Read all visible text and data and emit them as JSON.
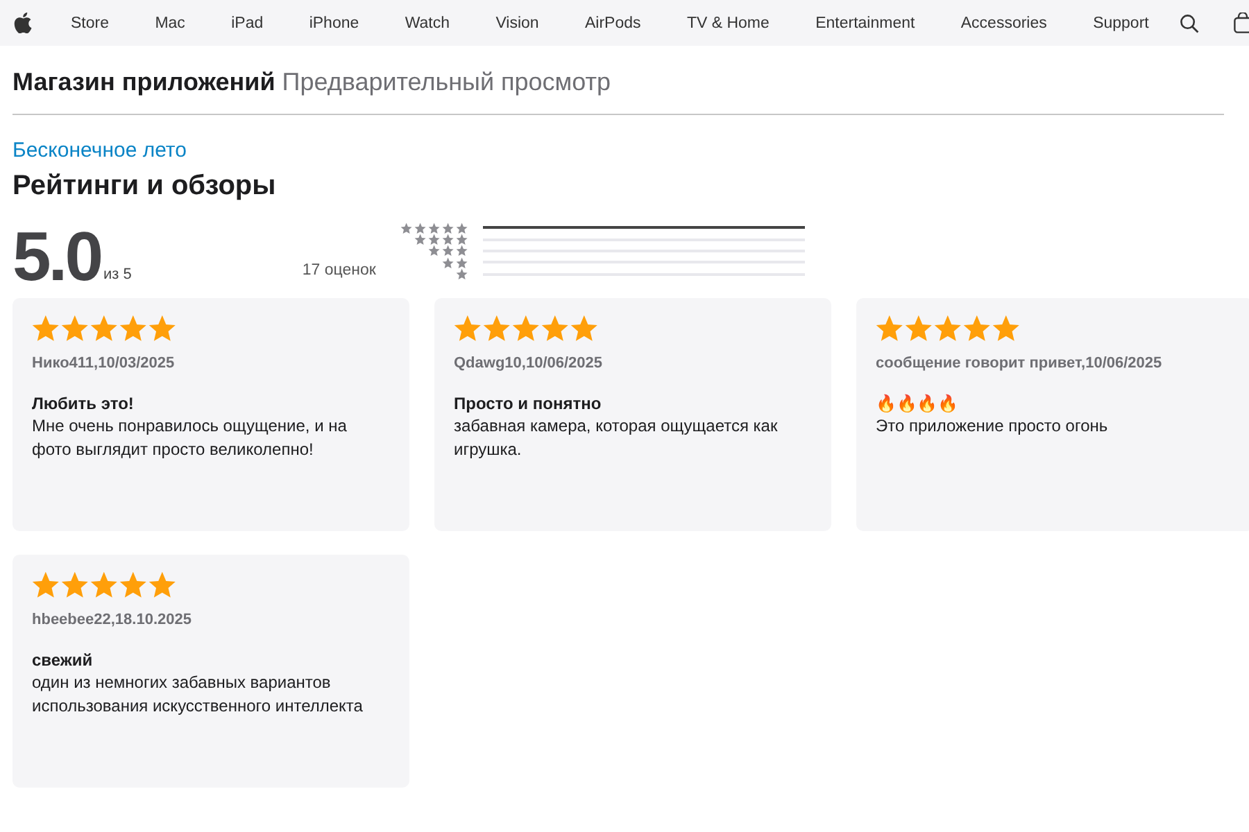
{
  "nav": {
    "items": [
      "Store",
      "Mac",
      "iPad",
      "iPhone",
      "Watch",
      "Vision",
      "AirPods",
      "TV & Home",
      "Entertainment",
      "Accessories",
      "Support"
    ]
  },
  "header": {
    "title": "Магазин приложений",
    "subtitle": "Предварительный просмотр"
  },
  "app_name": "Бесконечное лето",
  "section_title": "Рейтинги и обзоры",
  "summary": {
    "score": "5.0",
    "out_of": "из 5",
    "count": "17 оценок"
  },
  "histogram": [
    {
      "level": 1.0
    },
    {
      "level": 0
    },
    {
      "level": 0
    },
    {
      "level": 0
    },
    {
      "level": 0
    }
  ],
  "reviews": [
    {
      "stars": 5,
      "author": "Нико411,10/03/2025",
      "title": "Любить это!",
      "body": "Мне очень понравилось ощущение, и на фото выглядит просто великолепно!"
    },
    {
      "stars": 5,
      "author": "Qdawg10,10/06/2025",
      "title": "Просто и понятно",
      "body": "забавная камера, которая ощущается как игрушка."
    },
    {
      "stars": 5,
      "author": "сообщение говорит привет,10/06/2025",
      "title": "🔥🔥🔥🔥",
      "body": "Это приложение просто огонь"
    },
    {
      "stars": 5,
      "author": "hbeebee22,18.10.2025",
      "title": "свежий",
      "body": "один из немногих забавных вариантов использования искусственного интеллекта"
    }
  ]
}
